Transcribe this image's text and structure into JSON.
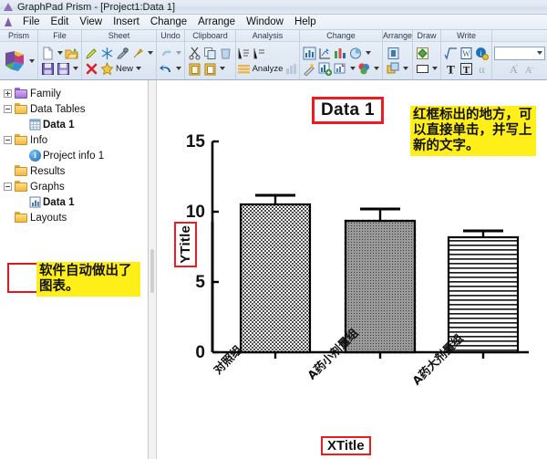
{
  "window": {
    "title": "GraphPad Prism - [Project1:Data 1]",
    "app_icon": "prism-logo-icon"
  },
  "menubar": {
    "logo_icon": "prism-logo-icon",
    "items": [
      {
        "label": "File"
      },
      {
        "label": "Edit"
      },
      {
        "label": "View"
      },
      {
        "label": "Insert"
      },
      {
        "label": "Change"
      },
      {
        "label": "Arrange"
      },
      {
        "label": "Window"
      },
      {
        "label": "Help"
      }
    ]
  },
  "ribbon": {
    "groups": [
      {
        "caption": "Prism"
      },
      {
        "caption": "File"
      },
      {
        "caption": "Sheet",
        "new_label": "New"
      },
      {
        "caption": "Undo"
      },
      {
        "caption": "Clipboard"
      },
      {
        "caption": "Analysis",
        "analyze_label": "Analyze"
      },
      {
        "caption": "Change"
      },
      {
        "caption": "Arrange"
      },
      {
        "caption": "Draw"
      },
      {
        "caption": "Write",
        "alpha_label": "α",
        "text_label": "T"
      },
      {
        "caption": ""
      }
    ]
  },
  "navigator": {
    "items": [
      {
        "label": "Family",
        "icon": "folder-purple-icon",
        "toggle": "plus",
        "level": 0,
        "bold": false
      },
      {
        "label": "Data Tables",
        "icon": "folder-icon",
        "toggle": "minus",
        "level": 0,
        "bold": false
      },
      {
        "label": "Data 1",
        "icon": "data-table-icon",
        "toggle": "none",
        "level": 1,
        "bold": true
      },
      {
        "label": "Info",
        "icon": "folder-icon",
        "toggle": "minus",
        "level": 0,
        "bold": false
      },
      {
        "label": "Project info 1",
        "icon": "info-icon",
        "toggle": "none",
        "level": 1,
        "bold": false
      },
      {
        "label": "Results",
        "icon": "folder-icon",
        "toggle": "none",
        "level": 0,
        "bold": false
      },
      {
        "label": "Graphs",
        "icon": "folder-icon",
        "toggle": "minus",
        "level": 0,
        "bold": false
      },
      {
        "label": "Data 1",
        "icon": "graph-sheet-icon",
        "toggle": "none",
        "level": 1,
        "bold": true
      },
      {
        "label": "Layouts",
        "icon": "folder-icon",
        "toggle": "none",
        "level": 0,
        "bold": false
      }
    ]
  },
  "annotations": {
    "note_left": "软件自动做出了图表。",
    "note_right": "红框标出的地方，可以直接单击，并写上新的文字。",
    "highlight_color": "#ffef18",
    "red_box_color": "#ee1c20"
  },
  "chart_data": {
    "type": "bar",
    "title": "Data 1",
    "xlabel": "XTitle",
    "ylabel": "YTitle",
    "categories": [
      "对照组",
      "A药小剂量组",
      "A药大剂量组"
    ],
    "values": [
      10.5,
      9.35,
      8.2
    ],
    "errors": [
      0.35,
      0.45,
      0.25
    ],
    "fills": [
      "checker",
      "dots-gray",
      "hlines"
    ],
    "yticks": [
      0,
      5,
      10,
      15
    ],
    "ylim": [
      0,
      15
    ],
    "grid": false,
    "legend": false
  }
}
